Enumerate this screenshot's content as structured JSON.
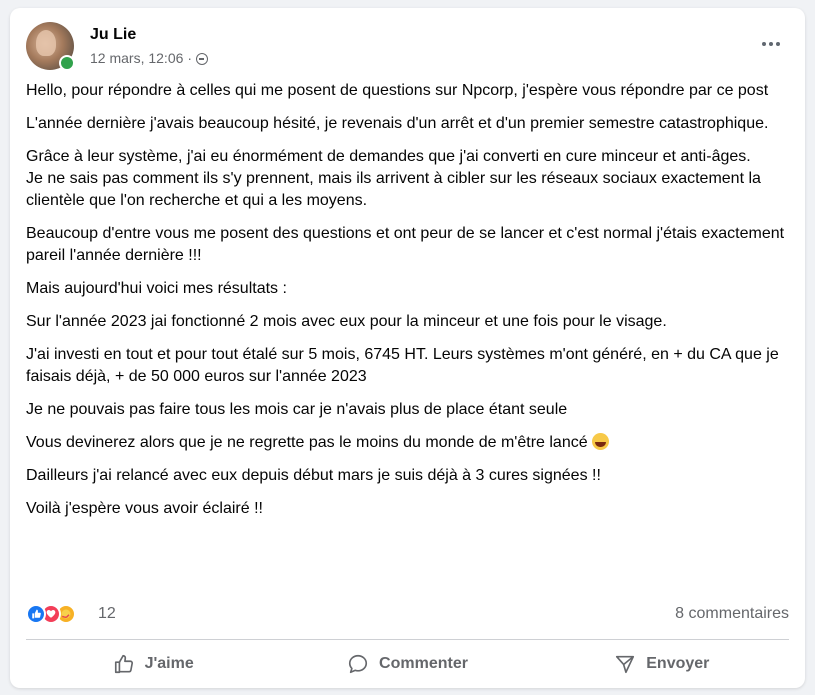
{
  "post": {
    "author": "Ju Lie",
    "timestamp": "12 mars, 12:06",
    "separator": "·",
    "privacy_icon": "globe-icon",
    "paragraphs": [
      "Hello, pour répondre à celles qui me posent de questions sur Npcorp, j'espère vous répondre par ce post",
      "L'année dernière j'avais beaucoup hésité, je revenais d'un arrêt et d'un premier semestre catastrophique.",
      "Grâce à leur système, j'ai eu énormément de demandes que j'ai converti en cure minceur et anti-âges.",
      "Je ne sais pas comment ils s'y prennent, mais ils arrivent à cibler sur les réseaux sociaux exactement la clientèle que l'on recherche et qui a les moyens.",
      "Beaucoup d'entre vous me posent des questions et ont peur de se lancer et c'est normal j'étais exactement pareil l'année dernière !!!",
      "Mais aujourd'hui voici mes résultats :",
      "Sur l'année 2023 jai fonctionné 2 mois avec eux pour la minceur et une fois pour le visage.",
      "J'ai investi en tout et pour tout étalé sur 5 mois, 6745 HT. Leurs systèmes m'ont généré, en + du CA que je faisais déjà, + de 50 000 euros sur l'année 2023",
      "Je ne pouvais pas faire tous les mois car je n'avais plus de place étant seule",
      "Vous devinerez alors que  je ne regrette pas le moins du monde de m'être lancé",
      "Dailleurs j'ai relancé avec eux depuis début mars je suis déjà à 3 cures signées !!",
      "Voilà j'espère vous avoir éclairé !!"
    ],
    "laughing_emoji": "laughing-emoji-icon"
  },
  "reactions": {
    "icons": [
      "like-icon",
      "love-icon",
      "care-icon"
    ],
    "count": "12",
    "comments": "8 commentaires"
  },
  "actions": {
    "like": "J'aime",
    "comment": "Commenter",
    "send": "Envoyer"
  },
  "colors": {
    "like_blue": "#1877f2",
    "love_red": "#f33e58",
    "care_yellow": "#f7b125",
    "online_green": "#31a24c",
    "secondary_text": "#65676b"
  }
}
